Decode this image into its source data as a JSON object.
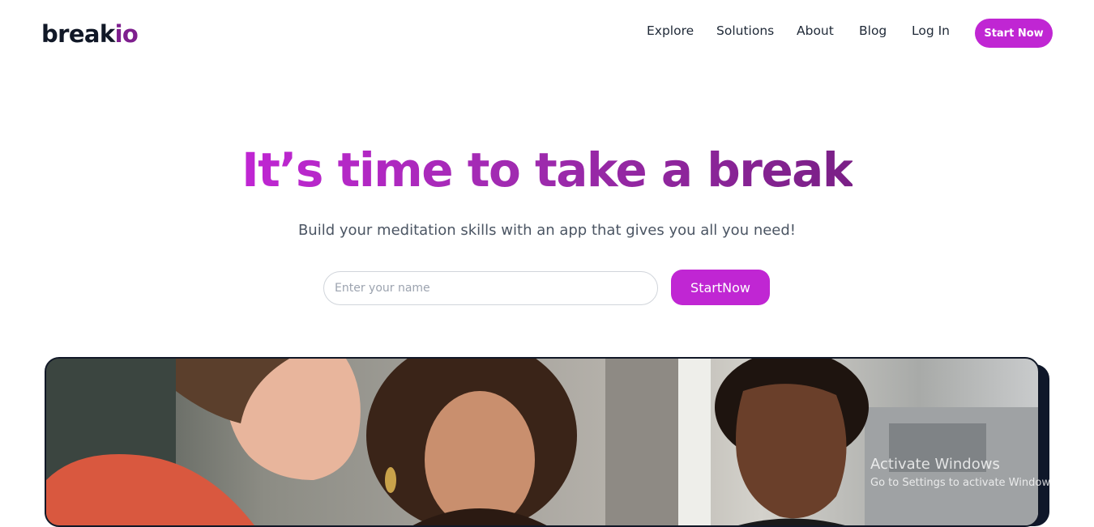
{
  "header": {
    "logo_main": "break",
    "logo_accent": "io",
    "nav": {
      "explore": "Explore",
      "solutions": "Solutions",
      "about": "About",
      "blog": "Blog",
      "login": "Log In"
    },
    "cta_label": "Start Now"
  },
  "hero": {
    "title": "It’s time to take a break",
    "subtitle": "Build your meditation skills with an app that gives you all you need!",
    "name_input_placeholder": "Enter your name",
    "name_input_value": "",
    "cta_label": "StartNow"
  },
  "watermark": {
    "title": "Activate Windows",
    "subtitle": "Go to Settings to activate Windows."
  },
  "colors": {
    "accent": "#c026d3",
    "accent_dark": "#7a1f86",
    "logo_accent": "#7e1f8e",
    "text_dark": "#111827"
  }
}
